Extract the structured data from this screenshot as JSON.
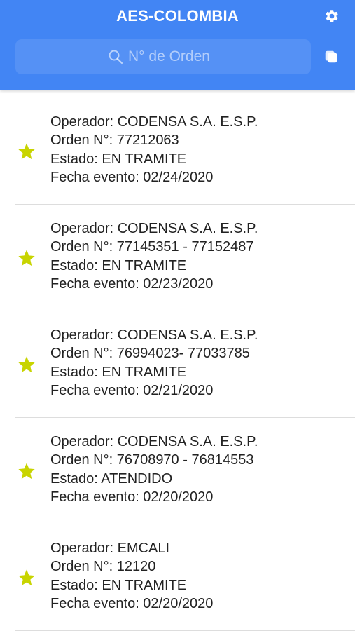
{
  "header": {
    "title": "AES-COLOMBIA",
    "settings_icon": "gear-icon",
    "copy_icon": "copy-icon",
    "background_color": "#4285f4"
  },
  "search": {
    "placeholder": "N° de Orden",
    "value": "",
    "icon": "search-icon"
  },
  "orders": [
    {
      "operador": "Operador: CODENSA S.A. E.S.P.",
      "orden": "Orden N°: 77212063",
      "estado": "Estado: EN TRAMITE",
      "fecha": "Fecha evento: 02/24/2020"
    },
    {
      "operador": "Operador: CODENSA S.A. E.S.P.",
      "orden": "Orden N°: 77145351 - 77152487",
      "estado": "Estado: EN TRAMITE",
      "fecha": "Fecha evento: 02/23/2020"
    },
    {
      "operador": "Operador: CODENSA S.A. E.S.P.",
      "orden": "Orden N°: 76994023- 77033785",
      "estado": "Estado: EN TRAMITE",
      "fecha": "Fecha evento: 02/21/2020"
    },
    {
      "operador": "Operador: CODENSA S.A. E.S.P.",
      "orden": "Orden N°: 76708970 - 76814553",
      "estado": "Estado: ATENDIDO",
      "fecha": "Fecha evento: 02/20/2020"
    },
    {
      "operador": "Operador: EMCALI",
      "orden": "Orden N°: 12120",
      "estado": "Estado: EN TRAMITE",
      "fecha": "Fecha evento: 02/20/2020"
    }
  ],
  "star_icon": "star-icon",
  "star_color": "#c8d400"
}
